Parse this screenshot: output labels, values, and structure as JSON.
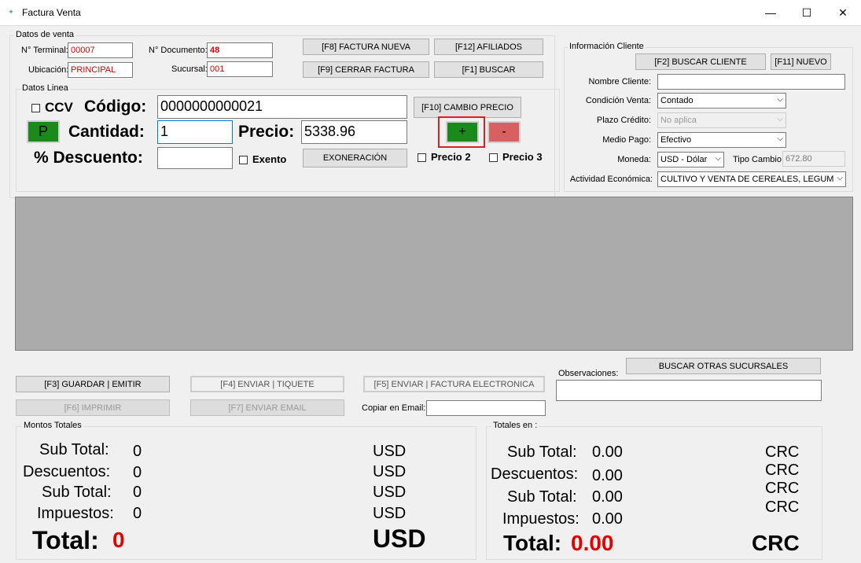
{
  "window": {
    "title": "Factura Venta",
    "minimize": "—",
    "maximize": "☐",
    "close": "✕"
  },
  "datos_venta": {
    "group_label": "Datos de venta",
    "terminal_label": "N° Terminal:",
    "terminal_value": "00007",
    "documento_label": "N° Documento:",
    "documento_value": "48",
    "ubicacion_label": "Ubicación:",
    "ubicacion_value": "PRINCIPAL",
    "sucursal_label": "Sucursal:",
    "sucursal_value": "001"
  },
  "top_buttons": {
    "f8": "[F8] FACTURA NUEVA",
    "f12": "[F12] AFILIADOS",
    "f9": "[F9] CERRAR FACTURA",
    "f1": "[F1] BUSCAR"
  },
  "datos_linea": {
    "group_label": "Datos Linea",
    "ccv_label": "CCV",
    "codigo_label": "Código:",
    "codigo_value": "0000000000021",
    "f10_button": "[F10] CAMBIO PRECIO",
    "p_button": "P",
    "cantidad_label": "Cantidad:",
    "cantidad_value": "1",
    "precio_label": "Precio:",
    "precio_value": "5338.96",
    "plus_button": "+",
    "minus_button": "-",
    "descuento_label": "% Descuento:",
    "descuento_value": "",
    "exento_label": "Exento",
    "exoneracion_button": "EXONERACIÓN",
    "precio2_label": "Precio 2",
    "precio3_label": "Precio 3"
  },
  "cliente": {
    "group_label": "Información Cliente",
    "buscar_button": "[F2] BUSCAR CLIENTE",
    "nuevo_button": "[F11] NUEVO",
    "nombre_label": "Nombre Cliente:",
    "nombre_value": "",
    "condicion_label": "Condición Venta:",
    "condicion_value": "Contado",
    "plazo_label": "Plazo Crédito:",
    "plazo_value": "No aplica",
    "medio_label": "Medio Pago:",
    "medio_value": "Efectivo",
    "moneda_label": "Moneda:",
    "moneda_value": "USD - Dólar",
    "tipo_cambio_label": "Tipo Cambio:",
    "tipo_cambio_value": "672.80",
    "actividad_label": "Actividad Económica:",
    "actividad_value": "CULTIVO Y VENTA DE CEREALES, LEGUM"
  },
  "actions": {
    "f3": "[F3] GUARDAR | EMITIR",
    "f4": "[F4] ENVIAR | TIQUETE",
    "f5": "[F5] ENVIAR | FACTURA ELECTRONICA",
    "f6": "[F6] IMPRIMIR",
    "f7": "[F7] ENVIAR EMAIL",
    "copiar_label": "Copiar en Email:",
    "copiar_value": "",
    "observaciones_label": "Observaciones:",
    "observaciones_value": "",
    "buscar_sucursales": "BUSCAR OTRAS SUCURSALES"
  },
  "montos": {
    "group_label": "Montos Totales",
    "subtotal_label": "Sub Total:",
    "subtotal_value": "0",
    "descuentos_label": "Descuentos:",
    "descuentos_value": "0",
    "subtotal2_label": "Sub Total:",
    "subtotal2_value": "0",
    "impuestos_label": "Impuestos:",
    "impuestos_value": "0",
    "total_label": "Total:",
    "total_value": "0",
    "currency": "USD"
  },
  "totales_en": {
    "group_label": "Totales en :",
    "subtotal_label": "Sub Total:",
    "subtotal_value": "0.00",
    "descuentos_label": "Descuentos:",
    "descuentos_value": "0.00",
    "subtotal2_label": "Sub Total:",
    "subtotal2_value": "0.00",
    "impuestos_label": "Impuestos:",
    "impuestos_value": "0.00",
    "total_label": "Total:",
    "total_value": "0.00",
    "currency": "CRC"
  },
  "colors": {
    "accent_red": "#e00000",
    "green_button": "#1a8a1a",
    "red_button": "#d86060",
    "grid_gray": "#ababab"
  }
}
